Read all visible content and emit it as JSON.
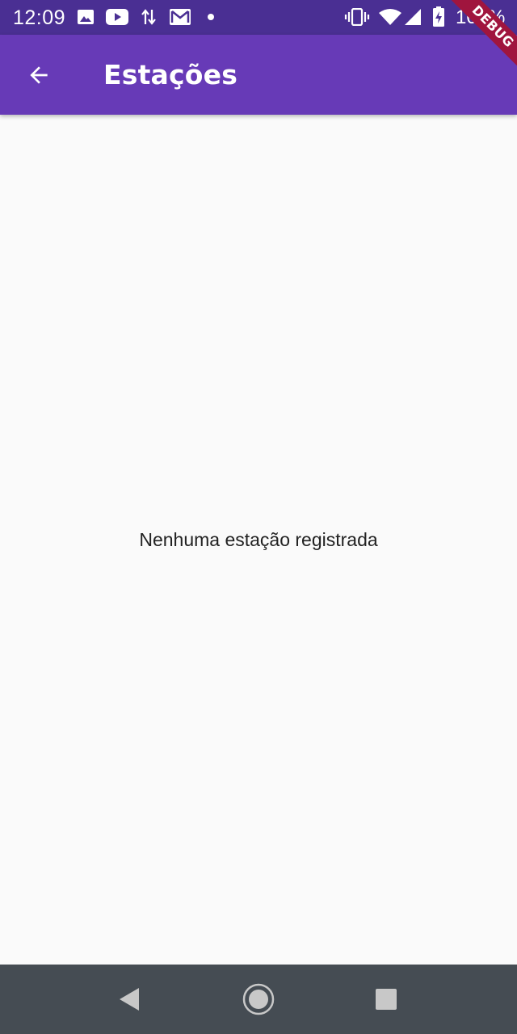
{
  "status_bar": {
    "time": "12:09",
    "battery": "100%",
    "icons": [
      "image-icon",
      "youtube-icon",
      "data-transfer-icon",
      "gmail-icon",
      "notification-dot-icon",
      "vibrate-icon",
      "wifi-icon",
      "signal-icon",
      "battery-charging-icon"
    ]
  },
  "app_bar": {
    "title": "Estações",
    "back_icon": "arrow-back-icon",
    "color": "#673ab7"
  },
  "debug_banner": {
    "label": "DEBUG"
  },
  "content": {
    "empty_message": "Nenhuma estação registrada"
  },
  "nav_bar": {
    "buttons": [
      "back-triangle-icon",
      "home-circle-icon",
      "recents-square-icon"
    ]
  }
}
